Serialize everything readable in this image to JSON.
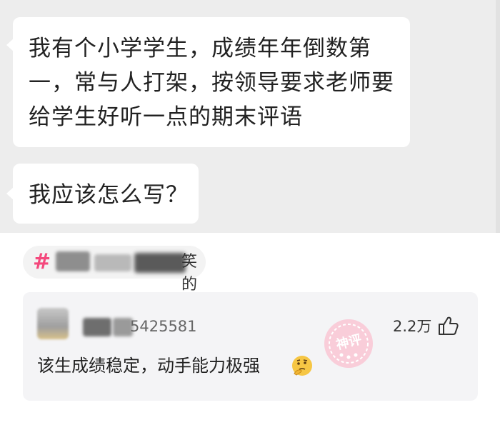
{
  "chat": {
    "message1": {
      "line1": "我有个小学学生，成绩年年倒数第",
      "line2": "一，常与人打架，按领导要求老师要",
      "line3": "给学生好听一点的期末评语"
    },
    "message2": {
      "text": "我应该怎么写？"
    }
  },
  "topic": {
    "hash_icon": "#",
    "visible_suffix": "笑的"
  },
  "comment": {
    "username_visible": "5425581",
    "like_count": "2.2万",
    "text": "该生成绩稳定，动手能力极强",
    "badge": "神评"
  },
  "colors": {
    "accent": "#f4497d",
    "chat_background": "#ededed",
    "card_background": "#f4f4f6"
  },
  "icons": {
    "hash": "hash-icon",
    "like": "thumbs-up-icon",
    "emoji": "thinking-face-icon"
  }
}
